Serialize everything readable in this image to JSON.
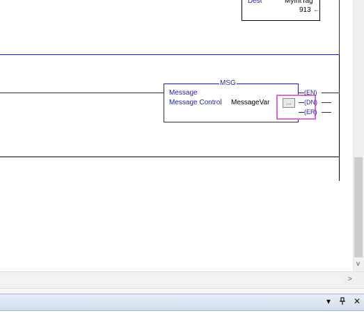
{
  "rung_top": {
    "dest_label": "Dest",
    "dest_tag": "MyIntTag",
    "dest_value": "913",
    "value_arrow": "←"
  },
  "msg_instruction": {
    "title": "MSG",
    "name_label": "Message",
    "control_label": "Message Control",
    "control_value": "MessageVar",
    "ellipsis": "...",
    "outputs": [
      "EN",
      "DN",
      "ER"
    ]
  },
  "scrollbars": {
    "v_down_arrow": "v",
    "h_right_arrow": ">"
  },
  "bottom_panel": {
    "dropdown_glyph": "▾",
    "pin_glyph": "ᵖ",
    "close_glyph": "✕"
  },
  "colors": {
    "ladder_blue": "#1c1cb4",
    "highlight_pink": "#d86ad8",
    "panel_header": "#dbe4f0"
  }
}
